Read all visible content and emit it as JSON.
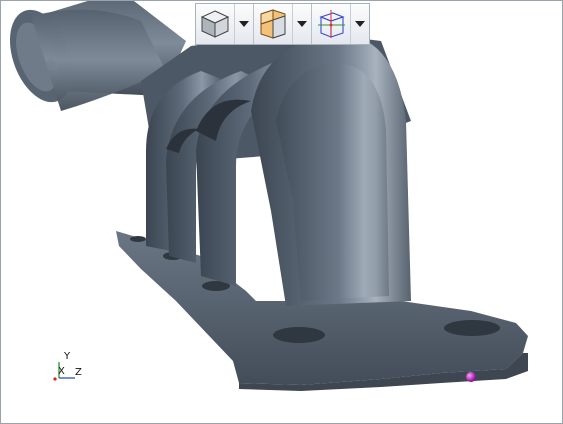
{
  "viewport": {
    "model": "exhaust-manifest",
    "model_color": "#4f5b69",
    "background": "#ffffff"
  },
  "toolbar": {
    "buttons": [
      {
        "icon": "display-style-shaded-cube-icon",
        "has_dropdown": true
      },
      {
        "icon": "section-view-icon",
        "has_dropdown": true
      },
      {
        "icon": "view-orientation-cube-icon",
        "has_dropdown": true
      }
    ]
  },
  "triad": {
    "y_label": "Y",
    "x_label": "X",
    "z_label": "Z"
  },
  "pivot_marker_color": "#a217a4"
}
